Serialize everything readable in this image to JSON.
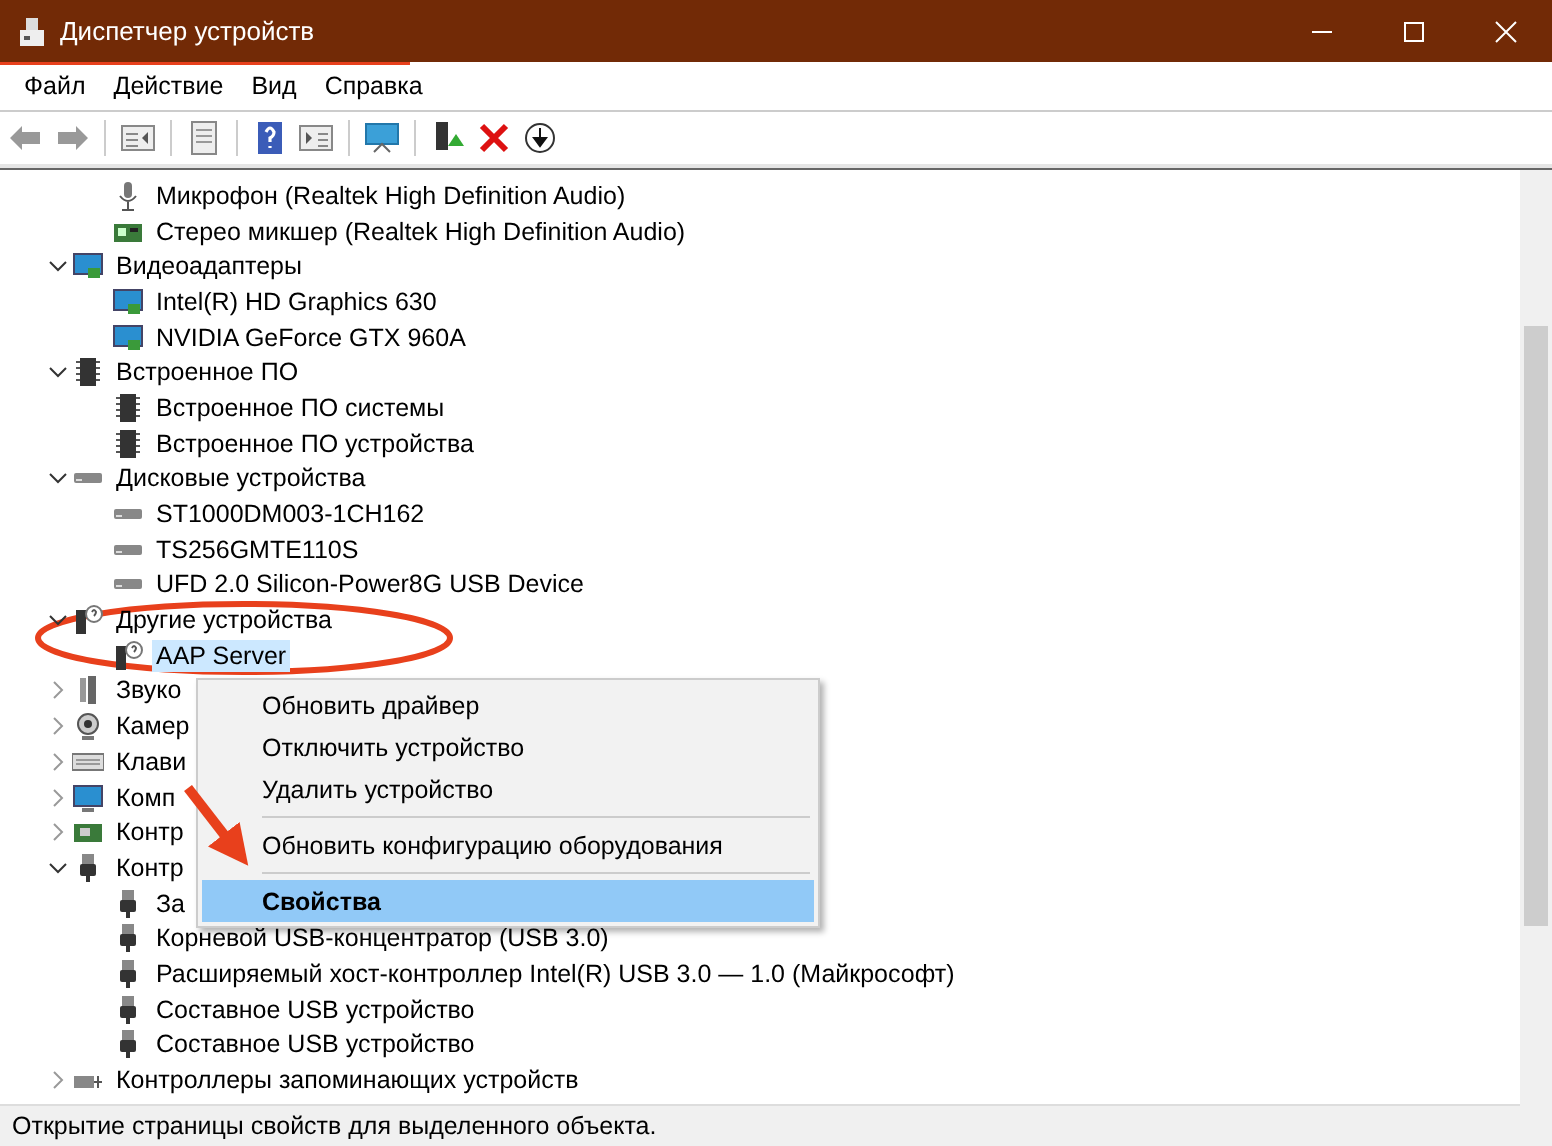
{
  "window": {
    "title": "Диспетчер устройств"
  },
  "menu": [
    "Файл",
    "Действие",
    "Вид",
    "Справка"
  ],
  "toolbar": [
    {
      "kind": "back"
    },
    {
      "kind": "forward"
    },
    {
      "kind": "sep"
    },
    {
      "kind": "list"
    },
    {
      "kind": "sep"
    },
    {
      "kind": "props"
    },
    {
      "kind": "sep"
    },
    {
      "kind": "help"
    },
    {
      "kind": "panel"
    },
    {
      "kind": "sep"
    },
    {
      "kind": "monitor"
    },
    {
      "kind": "sep"
    },
    {
      "kind": "update"
    },
    {
      "kind": "remove"
    },
    {
      "kind": "download"
    }
  ],
  "tree": [
    {
      "children": [
        {
          "label": "Микрофон (Realtek High Definition Audio)",
          "kind": "microphone",
          "selected": false
        },
        {
          "label": "Стерео микшер (Realtek High Definition Audio)",
          "kind": "mixer",
          "selected": false
        }
      ]
    },
    {
      "label": "Видеоадаптеры",
      "kind": "monitor",
      "expanded": true,
      "selected": false,
      "children": [
        {
          "label": "Intel(R) HD Graphics 630",
          "kind": "monitor",
          "selected": false
        },
        {
          "label": "NVIDIA GeForce GTX 960A",
          "kind": "monitor",
          "selected": false
        }
      ]
    },
    {
      "label": "Встроенное ПО",
      "kind": "chip",
      "expanded": true,
      "selected": false,
      "children": [
        {
          "label": "Встроенное ПО системы",
          "kind": "chip",
          "selected": false
        },
        {
          "label": "Встроенное ПО устройства",
          "kind": "chip",
          "selected": false
        }
      ]
    },
    {
      "label": "Дисковые устройства",
      "kind": "disk",
      "expanded": true,
      "selected": false,
      "children": [
        {
          "label": "ST1000DM003-1CH162",
          "kind": "disk",
          "selected": false
        },
        {
          "label": "TS256GMTE110S",
          "kind": "disk",
          "selected": false
        },
        {
          "label": "UFD 2.0 Silicon-Power8G USB Device",
          "kind": "disk",
          "selected": false
        }
      ]
    },
    {
      "label": "Другие устройства",
      "kind": "unknown",
      "expanded": true,
      "selected": false,
      "children": [
        {
          "label": "AAP Server",
          "kind": "unknown",
          "selected": true
        }
      ]
    },
    {
      "label": "Звуко",
      "kind": "speaker",
      "expanded": false,
      "selected": false
    },
    {
      "label": "Камер",
      "kind": "webcam",
      "expanded": false,
      "selected": false
    },
    {
      "label": "Клави",
      "kind": "keyboard",
      "expanded": false,
      "selected": false
    },
    {
      "label": "Комп",
      "kind": "computer",
      "expanded": false,
      "selected": false
    },
    {
      "label": "Контр",
      "kind": "controller",
      "expanded": false,
      "selected": false
    },
    {
      "label": "Контр",
      "kind": "usb",
      "expanded": true,
      "selected": false,
      "children": [
        {
          "label": "За",
          "kind": "usb",
          "selected": false
        },
        {
          "label": "Корневой USB-концентратор (USB 3.0)",
          "kind": "usb",
          "selected": false
        },
        {
          "label": "Расширяемый хост-контроллер Intel(R) USB 3.0 — 1.0 (Майкрософт)",
          "kind": "usb",
          "selected": false
        },
        {
          "label": "Составное USB устройство",
          "kind": "usb",
          "selected": false
        },
        {
          "label": "Составное USB устройство",
          "kind": "usb",
          "selected": false
        }
      ]
    },
    {
      "label": "Контроллеры запоминающих устройств",
      "kind": "storage",
      "expanded": false,
      "selected": false
    }
  ],
  "context_menu": [
    {
      "label": "Обновить драйвер",
      "selected": false,
      "separator_before": false
    },
    {
      "label": "Отключить устройство",
      "selected": false,
      "separator_before": false
    },
    {
      "label": "Удалить устройство",
      "selected": false,
      "separator_before": false
    },
    {
      "label": "Обновить конфигурацию оборудования",
      "selected": false,
      "separator_before": true
    },
    {
      "label": "Свойства",
      "selected": true,
      "separator_before": true
    }
  ],
  "status_bar": "Открытие страницы свойств для выделенного объекта."
}
